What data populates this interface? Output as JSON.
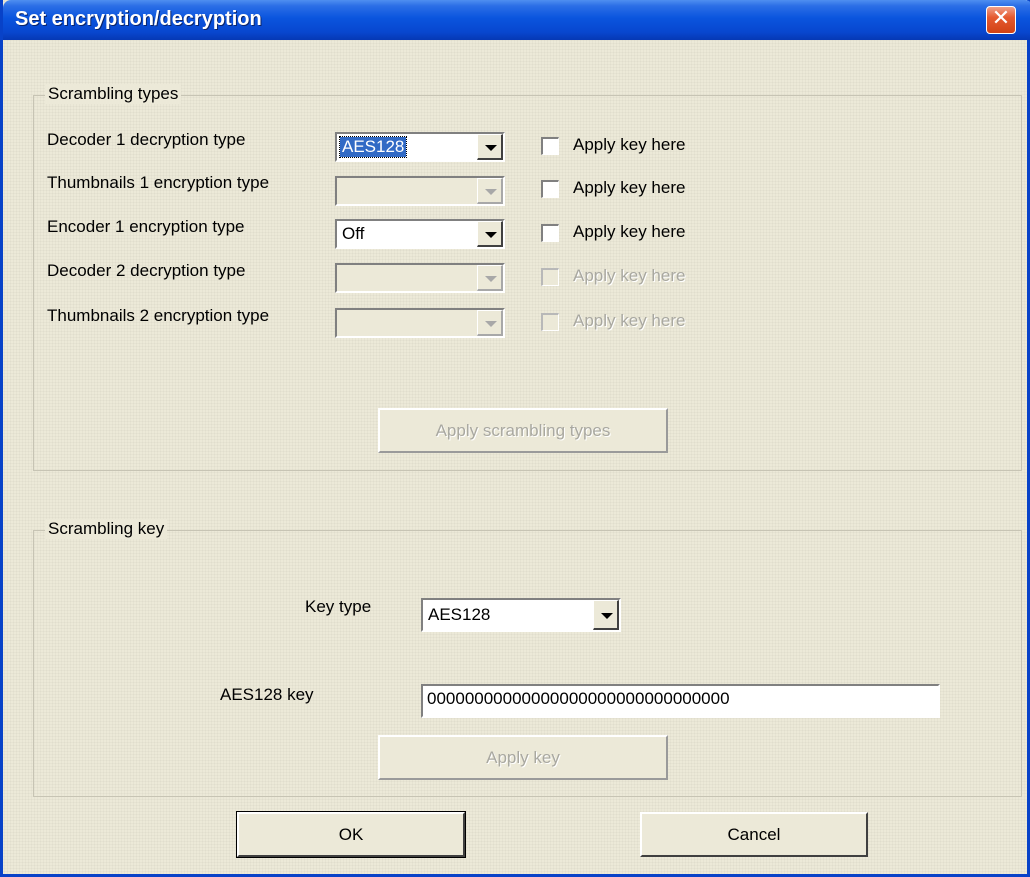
{
  "window": {
    "title": "Set encryption/decryption",
    "close_glyph": "✕"
  },
  "scrambling_types": {
    "group_title": "Scrambling types",
    "rows": [
      {
        "label": "Decoder 1 decryption type",
        "value": "AES128",
        "enabled": true,
        "selected": true,
        "checkbox_label": "Apply key here",
        "checkbox_checked": false,
        "checkbox_enabled": true
      },
      {
        "label": "Thumbnails 1 encryption type",
        "value": "",
        "enabled": false,
        "selected": false,
        "checkbox_label": "Apply key here",
        "checkbox_checked": false,
        "checkbox_enabled": true
      },
      {
        "label": "Encoder 1 encryption type",
        "value": "Off",
        "enabled": true,
        "selected": false,
        "checkbox_label": "Apply key here",
        "checkbox_checked": false,
        "checkbox_enabled": true
      },
      {
        "label": "Decoder 2 decryption type",
        "value": "",
        "enabled": false,
        "selected": false,
        "checkbox_label": "Apply key here",
        "checkbox_checked": false,
        "checkbox_enabled": false
      },
      {
        "label": "Thumbnails 2 encryption type",
        "value": "",
        "enabled": false,
        "selected": false,
        "checkbox_label": "Apply key here",
        "checkbox_checked": false,
        "checkbox_enabled": false
      }
    ],
    "apply_button": "Apply scrambling types"
  },
  "scrambling_key": {
    "group_title": "Scrambling key",
    "key_type_label": "Key type",
    "key_type_value": "AES128",
    "key_label": "AES128 key",
    "key_value": "00000000000000000000000000000000",
    "apply_button": "Apply key"
  },
  "footer": {
    "ok_label": "OK",
    "cancel_label": "Cancel"
  },
  "icons": {
    "dropdown": "chevron-down-icon",
    "close": "close-icon"
  },
  "colors": {
    "titlebar": "#0a55de",
    "close_button": "#e55a30",
    "selection": "#316ac5",
    "dialog_bg": "#ece9d8"
  }
}
